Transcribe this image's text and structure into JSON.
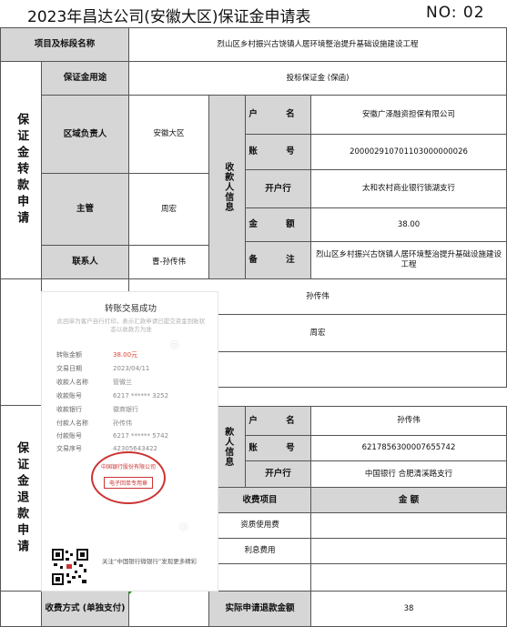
{
  "header": {
    "title": "2023年昌达公司(安徽大区)保证金申请表",
    "number": "NO: 02"
  },
  "form": {
    "project_label": "项目及标段名称",
    "project_value": "烈山区乡村振兴古饶镇人居环境整治提升基础设施建设工程",
    "purpose_label": "保证金用途",
    "purpose_value": "投标保证金 (保函)",
    "transfer_section_label": "保证金转款申请",
    "refund_section_label": "保证金退款申请",
    "region_label": "区域负责人",
    "region_value": "安徽大区",
    "supervisor_label": "主管",
    "supervisor_value": "周宏",
    "contact_label": "联系人",
    "contact_value": "曹-孙传伟",
    "payee_info_label": "收款人信息",
    "payee_info_label_partial": "款人信息",
    "account_name_label": "户 名",
    "account_name_value": "安徽广泽融资担保有限公司",
    "account_no_label": "账 号",
    "account_no_value": "200002910701103000000026",
    "bank_label": "开户行",
    "bank_value": "太和农村商业银行锁湖支行",
    "amount_label": "金 额",
    "amount_value": "38.00",
    "remark_label": "备 注",
    "remark_value": "烈山区乡村振兴古饶镇人居环境整治提升基础设施建设工程",
    "applicant_value": "孙传伟",
    "approver_value": "周宏",
    "refund_name_value": "孙传伟",
    "refund_account_value": "6217856300007655742",
    "refund_bank_value": "中国银行 合肥清溪路支行",
    "fee_item_label": "收费项目",
    "fee_amount_label": "金 额",
    "fee_service": "资质使用费",
    "fee_interest": "利息费用",
    "fee_method_label": "收费方式 (单独支付)",
    "actual_refund_label": "实际申请退款金额",
    "actual_refund_value": "38"
  },
  "receipt": {
    "title": "转账交易成功",
    "note": "此回单为客户自行打印，表示汇款申请已提交资金到账状态以收款方为准",
    "rows": [
      {
        "k": "转账金额",
        "v": "38.00元"
      },
      {
        "k": "交易日期",
        "v": "2023/04/11"
      },
      {
        "k": "收款人名称",
        "v": "管微兰"
      },
      {
        "k": "收款账号",
        "v": "6217 ****** 3252"
      },
      {
        "k": "收款银行",
        "v": "徽商银行"
      },
      {
        "k": "付款人名称",
        "v": "孙传伟"
      },
      {
        "k": "付款账号",
        "v": "6217 ****** 5742"
      },
      {
        "k": "交易序号",
        "v": "42305643422"
      }
    ],
    "stamp_text": "中国银行股份有限公司",
    "stamp_sub": "电子回单专用章",
    "follow_text": "关注“中国银行微银行”发现更多精彩",
    "accent_color": "#d43",
    "stamp_color": "#c33"
  }
}
